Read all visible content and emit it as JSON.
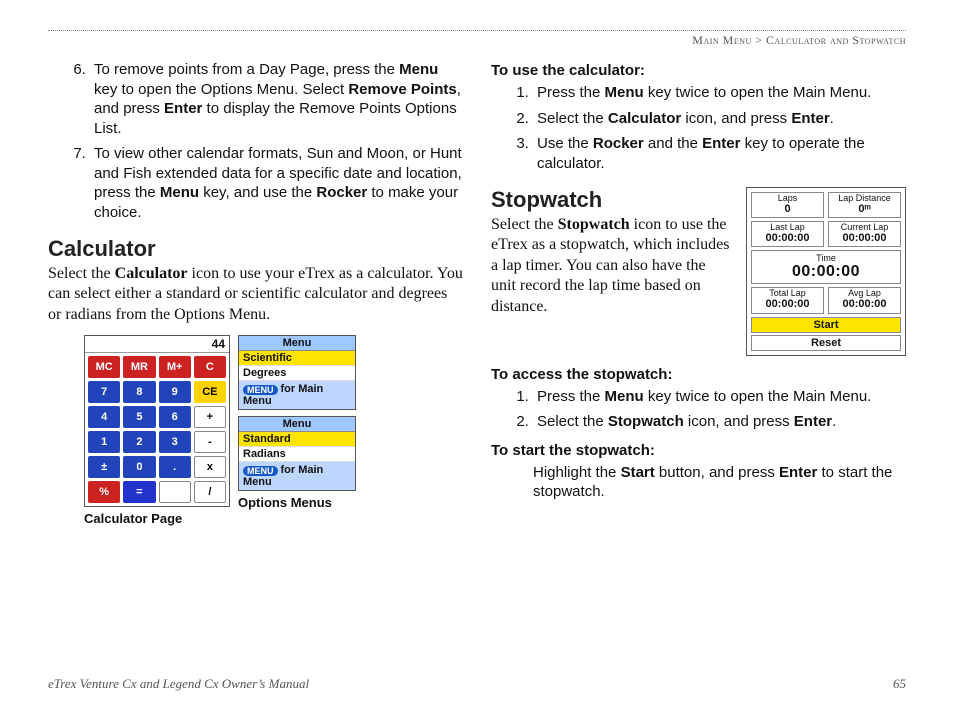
{
  "header": {
    "breadcrumb": "Main Menu > Calculator and Stopwatch"
  },
  "left": {
    "list_start": 6,
    "items": [
      "To remove points from a Day Page, press the <b>Menu</b> key to open the Options Menu. Select <b>Remove Points</b>, and press <b>Enter</b> to display the Remove Points Options List.",
      "To view other calendar formats, Sun and Moon, or Hunt and Fish extended data for a specific date and location, press the <b>Menu</b> key, and use the <b>Rocker</b> to make your choice."
    ],
    "calc_heading": "Calculator",
    "calc_para": "Select the <b>Calculator</b> icon to use your eTrex as a calculator. You can select either a standard or scientific calculator and degrees or radians from the Options Menu.",
    "calculator": {
      "display": "44",
      "keys": [
        {
          "t": "MC",
          "c": "kr"
        },
        {
          "t": "MR",
          "c": "kr"
        },
        {
          "t": "M+",
          "c": "kr"
        },
        {
          "t": "C",
          "c": "kr"
        },
        {
          "t": "7",
          "c": "kb"
        },
        {
          "t": "8",
          "c": "kb"
        },
        {
          "t": "9",
          "c": "kb"
        },
        {
          "t": "CE",
          "c": "ky"
        },
        {
          "t": "4",
          "c": "kb"
        },
        {
          "t": "5",
          "c": "kb"
        },
        {
          "t": "6",
          "c": "kb"
        },
        {
          "t": "+",
          "c": "kw"
        },
        {
          "t": "1",
          "c": "kb"
        },
        {
          "t": "2",
          "c": "kb"
        },
        {
          "t": "3",
          "c": "kb"
        },
        {
          "t": "-",
          "c": "kw"
        },
        {
          "t": "±",
          "c": "kb"
        },
        {
          "t": "0",
          "c": "kb"
        },
        {
          "t": ".",
          "c": "kb"
        },
        {
          "t": "x",
          "c": "kw"
        },
        {
          "t": "%",
          "c": "kr"
        },
        {
          "t": "=",
          "c": "kbl"
        },
        {
          "t": "",
          "c": "kw"
        },
        {
          "t": "/",
          "c": "kw"
        }
      ],
      "caption": "Calculator Page"
    },
    "option_menus": {
      "title": "Menu",
      "menu1": [
        "Scientific",
        "Degrees"
      ],
      "menu2": [
        "Standard",
        "Radians"
      ],
      "foot_label": "MENU",
      "foot_text": "for Main Menu",
      "caption": "Options Menus"
    }
  },
  "right": {
    "use_calc_head": "To use the calculator:",
    "use_calc_steps": [
      "Press the <b>Menu</b> key twice to open the Main Menu.",
      "Select the <b>Calculator</b> icon, and press <b>Enter</b>.",
      "Use the <b>Rocker</b> and the <b>Enter</b> key to operate the calculator."
    ],
    "sw_heading": "Stopwatch",
    "sw_para": "Select the <b>Stopwatch</b> icon to use the eTrex as a stopwatch, which includes a lap timer. You can also have the unit record the lap time based on distance.",
    "stopwatch": {
      "laps_label": "Laps",
      "laps": "0",
      "lapdist_label": "Lap Distance",
      "lapdist": "0ᵐ",
      "lastlap_label": "Last Lap",
      "lastlap": "00:00:00",
      "curlap_label": "Current Lap",
      "curlap": "00:00:00",
      "time_label": "Time",
      "time": "00:00:00",
      "totallap_label": "Total Lap",
      "totallap": "00:00:00",
      "avglap_label": "Avg Lap",
      "avglap": "00:00:00",
      "start": "Start",
      "reset": "Reset"
    },
    "access_head": "To access the stopwatch:",
    "access_steps": [
      "Press the <b>Menu</b> key twice to open the Main Menu.",
      "Select the <b>Stopwatch</b> icon, and press <b>Enter</b>."
    ],
    "start_head": "To start the stopwatch:",
    "start_text": "Highlight the <b>Start</b> button, and press <b>Enter</b> to start the stopwatch."
  },
  "footer": {
    "title": "eTrex Venture Cx and Legend Cx Owner’s Manual",
    "page": "65"
  }
}
